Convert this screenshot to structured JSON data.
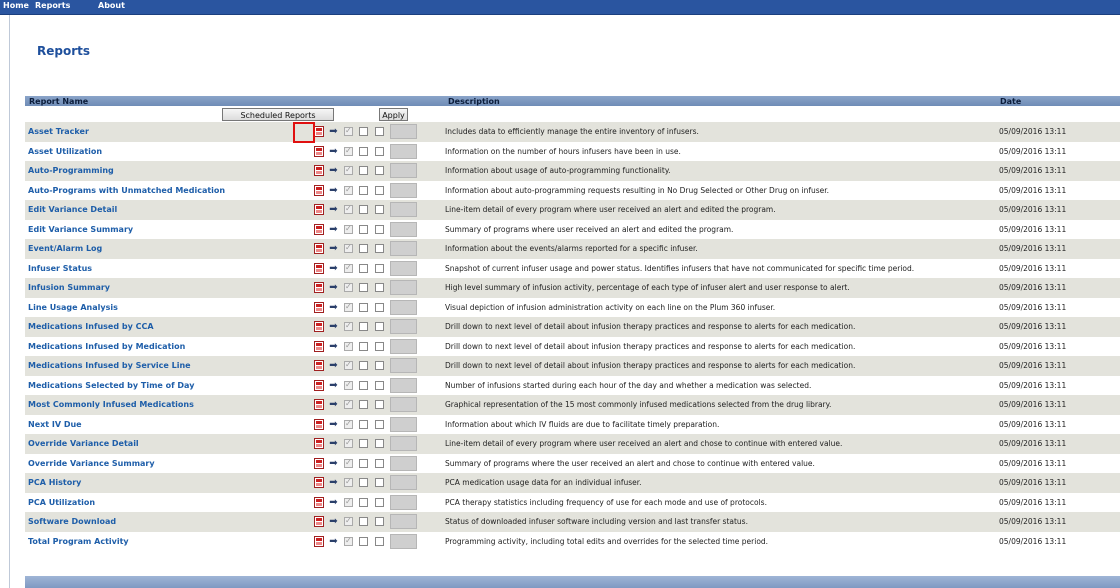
{
  "nav": {
    "items": [
      {
        "label": "Home"
      },
      {
        "label": "Reports"
      },
      {
        "label": "About"
      }
    ]
  },
  "page": {
    "title": "Reports"
  },
  "table": {
    "columns": {
      "name": "Report Name",
      "description": "Description",
      "date": "Date"
    },
    "controls": {
      "scheduled_label": "Scheduled Reports",
      "apply_label": "Apply"
    },
    "rows": [
      {
        "name": "Asset Tracker",
        "description": "Includes data to efficiently manage the entire inventory of infusers.",
        "date": "05/09/2016 13:11"
      },
      {
        "name": "Asset Utilization",
        "description": "Information on the number of hours infusers have been in use.",
        "date": "05/09/2016 13:11"
      },
      {
        "name": "Auto-Programming",
        "description": "Information about usage of auto-programming functionality.",
        "date": "05/09/2016 13:11"
      },
      {
        "name": "Auto-Programs with Unmatched Medication",
        "description": "Information about auto-programming requests resulting in No Drug Selected or Other Drug on infuser.",
        "date": "05/09/2016 13:11"
      },
      {
        "name": "Edit Variance Detail",
        "description": "Line-item detail of every program where user received an alert and edited the program.",
        "date": "05/09/2016 13:11"
      },
      {
        "name": "Edit Variance Summary",
        "description": "Summary of programs where user received an alert and edited the program.",
        "date": "05/09/2016 13:11"
      },
      {
        "name": "Event/Alarm Log",
        "description": "Information about the events/alarms reported for a specific infuser.",
        "date": "05/09/2016 13:11"
      },
      {
        "name": "Infuser Status",
        "description": "Snapshot of current infuser usage and power status. Identifies infusers that have not communicated for specific time period.",
        "date": "05/09/2016 13:11"
      },
      {
        "name": "Infusion Summary",
        "description": "High level summary of infusion activity, percentage of each type of infuser alert and user response to alert.",
        "date": "05/09/2016 13:11"
      },
      {
        "name": "Line Usage Analysis",
        "description": "Visual depiction of infusion administration activity on each line on the Plum 360 infuser.",
        "date": "05/09/2016 13:11"
      },
      {
        "name": "Medications Infused by CCA",
        "description": "Drill down to next level of detail about infusion therapy practices and response to alerts for each medication.",
        "date": "05/09/2016 13:11"
      },
      {
        "name": "Medications Infused by Medication",
        "description": "Drill down to next level of detail about infusion therapy practices and response to alerts for each medication.",
        "date": "05/09/2016 13:11"
      },
      {
        "name": "Medications Infused by Service Line",
        "description": "Drill down to next level of detail about infusion therapy practices and response to alerts for each medication.",
        "date": "05/09/2016 13:11"
      },
      {
        "name": "Medications Selected by Time of Day",
        "description": "Number of infusions started during each hour of the day and whether a medication was selected.",
        "date": "05/09/2016 13:11"
      },
      {
        "name": "Most Commonly Infused Medications",
        "description": "Graphical representation of the 15 most commonly infused medications selected from the drug library.",
        "date": "05/09/2016 13:11"
      },
      {
        "name": "Next IV Due",
        "description": "Information about which IV fluids are due to facilitate timely preparation.",
        "date": "05/09/2016 13:11"
      },
      {
        "name": "Override Variance Detail",
        "description": "Line-item detail of every program where user received an alert and chose to continue with entered value.",
        "date": "05/09/2016 13:11"
      },
      {
        "name": "Override Variance Summary",
        "description": "Summary of programs where the user received an alert and chose to continue with entered value.",
        "date": "05/09/2016 13:11"
      },
      {
        "name": "PCA History",
        "description": "PCA medication usage data for an individual infuser.",
        "date": "05/09/2016 13:11"
      },
      {
        "name": "PCA Utilization",
        "description": "PCA therapy statistics including frequency of use for each mode and use of protocols.",
        "date": "05/09/2016 13:11"
      },
      {
        "name": "Software Download",
        "description": "Status of downloaded infuser software including version and last transfer status.",
        "date": "05/09/2016 13:11"
      },
      {
        "name": "Total Program Activity",
        "description": "Programming activity, including total edits and overrides for the selected time period.",
        "date": "05/09/2016 13:11"
      }
    ]
  },
  "icons": {
    "pdf": "pdf-report-icon",
    "export": "export-arrow-icon"
  },
  "colors": {
    "nav_bar": "#2a55a0",
    "link": "#1e5ea9",
    "header": "#7f99c2",
    "row_alt": "#e3e3dc",
    "highlight": "#e01010"
  }
}
